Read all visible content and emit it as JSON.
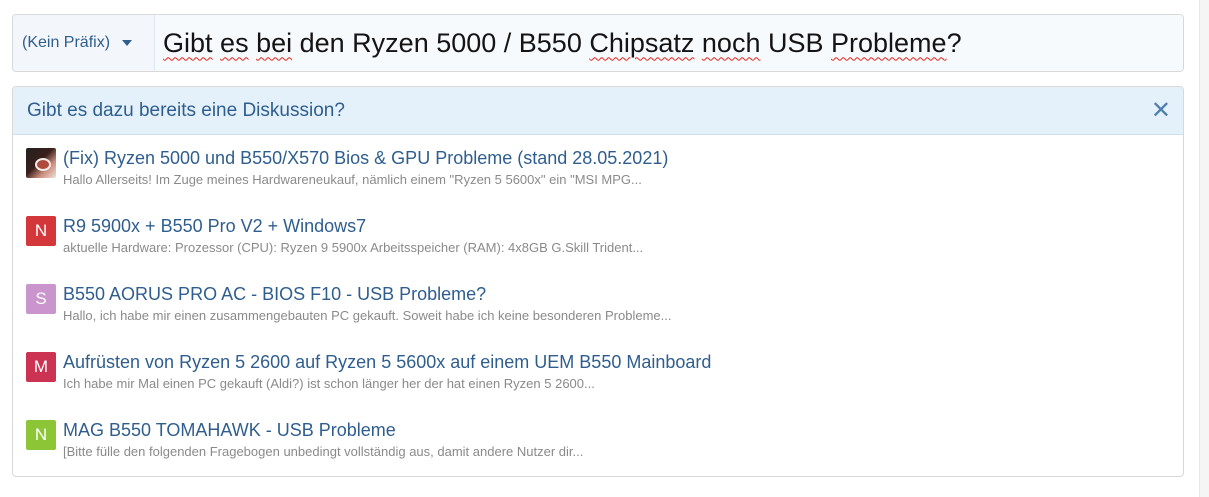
{
  "title_row": {
    "prefix_label": "(Kein Präfix)",
    "title_words": [
      {
        "text": "Gibt",
        "spell": true
      },
      {
        "text": " ",
        "spell": false
      },
      {
        "text": "es",
        "spell": true
      },
      {
        "text": " ",
        "spell": false
      },
      {
        "text": "bei",
        "spell": true
      },
      {
        "text": " den Ryzen 5000 / B550 ",
        "spell": false
      },
      {
        "text": "Chipsatz",
        "spell": true
      },
      {
        "text": " ",
        "spell": false
      },
      {
        "text": "noch",
        "spell": true
      },
      {
        "text": " USB ",
        "spell": false
      },
      {
        "text": "Probleme",
        "spell": true
      },
      {
        "text": "?",
        "spell": false
      }
    ],
    "spell_color": "#e0251c"
  },
  "panel": {
    "title": "Gibt es dazu bereits eine Diskussion?",
    "close_icon": "close-icon",
    "items": [
      {
        "avatar_type": "image",
        "avatar_letter": "",
        "avatar_color": "",
        "title": "(Fix) Ryzen 5000 und B550/X570 Bios & GPU Probleme (stand 28.05.2021)",
        "snippet": "Hallo Allerseits! Im Zuge meines Hardwareneukauf, nämlich einem \"Ryzen 5 5600x\" ein \"MSI MPG..."
      },
      {
        "avatar_type": "letter",
        "avatar_letter": "N",
        "avatar_color": "#d3373a",
        "title": "R9 5900x + B550 Pro V2 + Windows7",
        "snippet": "aktuelle Hardware: Prozessor (CPU): Ryzen 9 5900x Arbeitsspeicher (RAM): 4x8GB G.Skill Trident..."
      },
      {
        "avatar_type": "letter",
        "avatar_letter": "S",
        "avatar_color": "#c995cc",
        "title": "B550 AORUS PRO AC - BIOS F10 - USB Probleme?",
        "snippet": "Hallo, ich habe mir einen zusammengebauten PC gekauft. Soweit habe ich keine besonderen Probleme..."
      },
      {
        "avatar_type": "letter",
        "avatar_letter": "M",
        "avatar_color": "#cc3352",
        "title": "Aufrüsten von Ryzen 5 2600 auf Ryzen 5 5600x auf einem UEM B550 Mainboard",
        "snippet": "Ich habe mir Mal einen PC gekauft (Aldi?) ist schon länger her der hat einen Ryzen 5 2600..."
      },
      {
        "avatar_type": "letter",
        "avatar_letter": "N",
        "avatar_color": "#8cc637",
        "title": "MAG B550 TOMAHAWK - USB Probleme",
        "snippet": "[Bitte fülle den folgenden Fragebogen unbedingt vollständig aus, damit andere Nutzer dir..."
      }
    ]
  }
}
